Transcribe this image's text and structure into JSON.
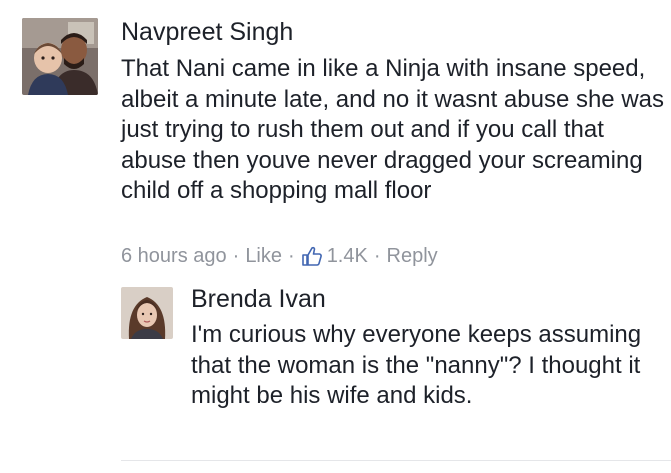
{
  "comments": [
    {
      "author": "Navpreet Singh",
      "text": "That Nani came in like a Ninja with insane speed, albeit a minute late, and no it wasnt abuse she was just trying to rush them out and if you call that abuse then youve never dragged your screaming child off a shopping mall floor",
      "time": "6 hours ago",
      "like_label": "Like",
      "like_count": "1.4K",
      "reply_label": "Reply",
      "avatar_icon": "profile-photo-man-with-child"
    },
    {
      "author": "Brenda Ivan",
      "text": "I'm curious why everyone keeps assuming that the woman is the \"nanny\"? I thought it might be his wife and kids.",
      "avatar_icon": "profile-photo-woman"
    }
  ],
  "colors": {
    "text": "#1d2129",
    "meta": "#90949c",
    "divider": "#e5e6e9"
  }
}
